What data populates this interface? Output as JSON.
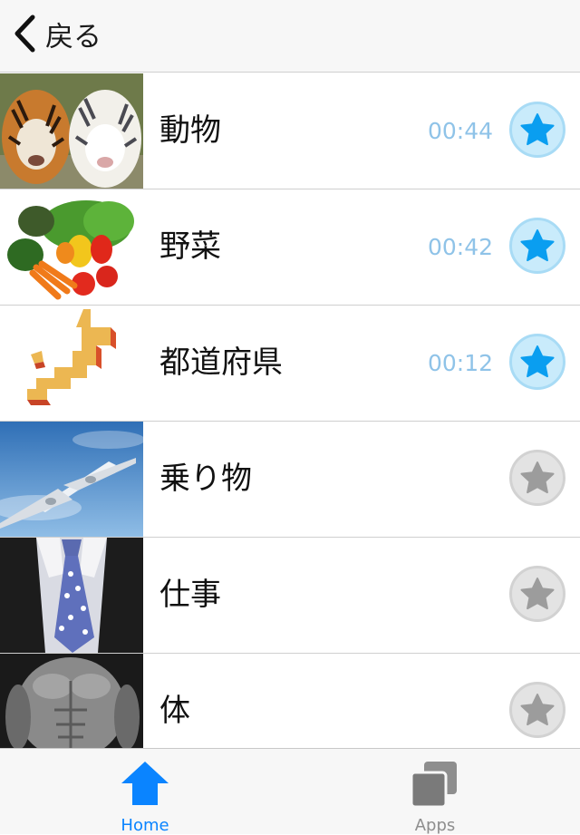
{
  "nav": {
    "back_label": "戻る"
  },
  "items": [
    {
      "title": "動物",
      "time": "00:44",
      "favorite": true,
      "thumb_icon": "tigers-photo"
    },
    {
      "title": "野菜",
      "time": "00:42",
      "favorite": true,
      "thumb_icon": "vegetables-photo"
    },
    {
      "title": "都道府県",
      "time": "00:12",
      "favorite": true,
      "thumb_icon": "japan-map-photo"
    },
    {
      "title": "乗り物",
      "time": "",
      "favorite": false,
      "thumb_icon": "airplane-photo"
    },
    {
      "title": "仕事",
      "time": "",
      "favorite": false,
      "thumb_icon": "necktie-photo"
    },
    {
      "title": "体",
      "time": "",
      "favorite": false,
      "thumb_icon": "torso-photo"
    }
  ],
  "tabs": {
    "home_label": "Home",
    "apps_label": "Apps"
  },
  "colors": {
    "accent": "#0a84ff",
    "star_on": "#0a9ef0",
    "star_off": "#9c9c9c",
    "time": "#8fc3e8"
  }
}
